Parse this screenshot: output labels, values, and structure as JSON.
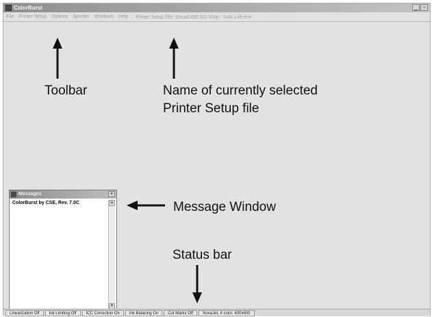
{
  "window": {
    "title": "ColorBurst",
    "minimize_glyph": "_",
    "maximize_glyph": "▫"
  },
  "menubar": {
    "items": [
      "File",
      "Printer Setup",
      "Options",
      "Spooler",
      "Windows",
      "Help"
    ],
    "printer_setup_file": "Printer Setup File: Encad 850 GO Vinyl - 1x4c Left.env"
  },
  "annotations": {
    "toolbar": "Toolbar",
    "name_line1": "Name of currently selected",
    "name_line2": "Printer Setup file",
    "message_window": "Message Window",
    "status_bar": "Status bar"
  },
  "message_window": {
    "title": "Messages",
    "close_glyph": "×",
    "lines": [
      "ColorBurst by CSE, Rev. 7.0C"
    ]
  },
  "statusbar": {
    "cells": [
      "Linearization Off",
      "Ink Limiting Off",
      "ICC Correction On",
      "Ink Balacing On",
      "Cut Marks Off",
      "NovaJet, 4 color, 600x600"
    ]
  },
  "icons": {
    "app": "app-icon",
    "arrow": "arrow-icon"
  }
}
